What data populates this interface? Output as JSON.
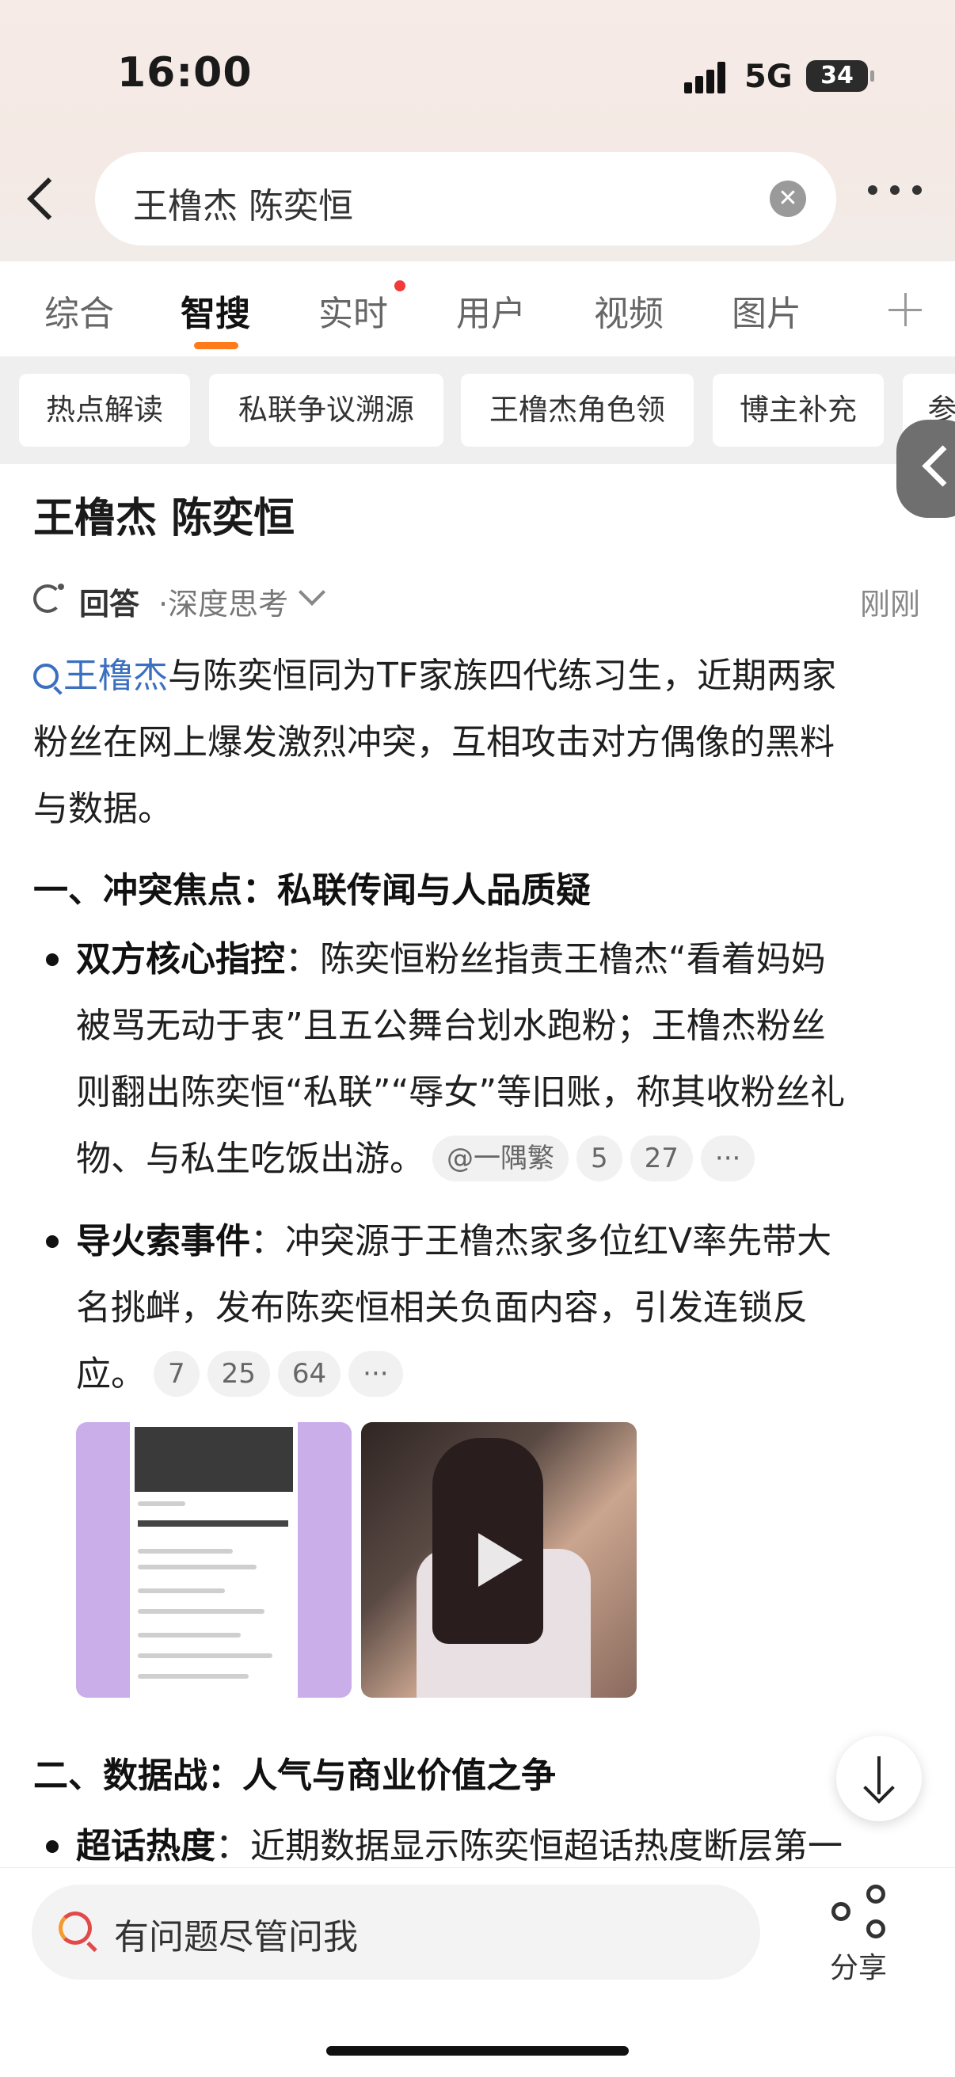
{
  "status": {
    "time": "16:00",
    "network": "5G",
    "battery": "34"
  },
  "search": {
    "query": "王橹杰 陈奕恒"
  },
  "tabs": [
    "综合",
    "智搜",
    "实时",
    "用户",
    "视频",
    "图片"
  ],
  "active_tab": "智搜",
  "chips": [
    "热点解读",
    "私联争议溯源",
    "王橹杰角色领",
    "博主补充",
    "参"
  ],
  "content": {
    "title": "王橹杰 陈奕恒",
    "answer_label": "回答",
    "answer_mode": "·深度思考",
    "answer_time": "刚刚",
    "intro_link": "王橹杰",
    "intro_line1": "与陈奕恒同为TF家族四代练习生，近期两家",
    "intro_line2": "粉丝在网上爆发激烈冲突，互相攻击对方偶像的黑料",
    "intro_line3": "与数据。",
    "section1": "一、冲突焦点：私联传闻与人品质疑",
    "b1_title": "双方核心指控",
    "b1_line1": "：陈奕恒粉丝指责王橹杰“看着妈妈",
    "b1_line2": "被骂无动于衷”且五公舞台划水跑粉；王橹杰粉丝",
    "b1_line3": "则翻出陈奕恒“私联”“辱女”等旧账，称其收粉丝礼",
    "b1_line4": "物、与私生吃饭出游。",
    "b1_cites": [
      "@一隅繁",
      "5",
      "27",
      "···"
    ],
    "b2_title": "导火索事件",
    "b2_line1": "：冲突源于王橹杰家多位红V率先带大",
    "b2_line2": "名挑衅，发布陈奕恒相关负面内容，引发连锁反",
    "b2_line3": "应。",
    "b2_cites": [
      "7",
      "25",
      "64",
      "···"
    ],
    "section2": "二、数据战：人气与商业价值之争",
    "b3_title": "超话热度",
    "b3_line1": "：近期数据显示陈奕恒超话热度断层第一"
  },
  "bottom": {
    "ask_placeholder": "有问题尽管问我",
    "share_label": "分享"
  },
  "colors": {
    "accent": "#ff7a1a",
    "link": "#3b6fc0",
    "chip_bg": "#efefef"
  }
}
